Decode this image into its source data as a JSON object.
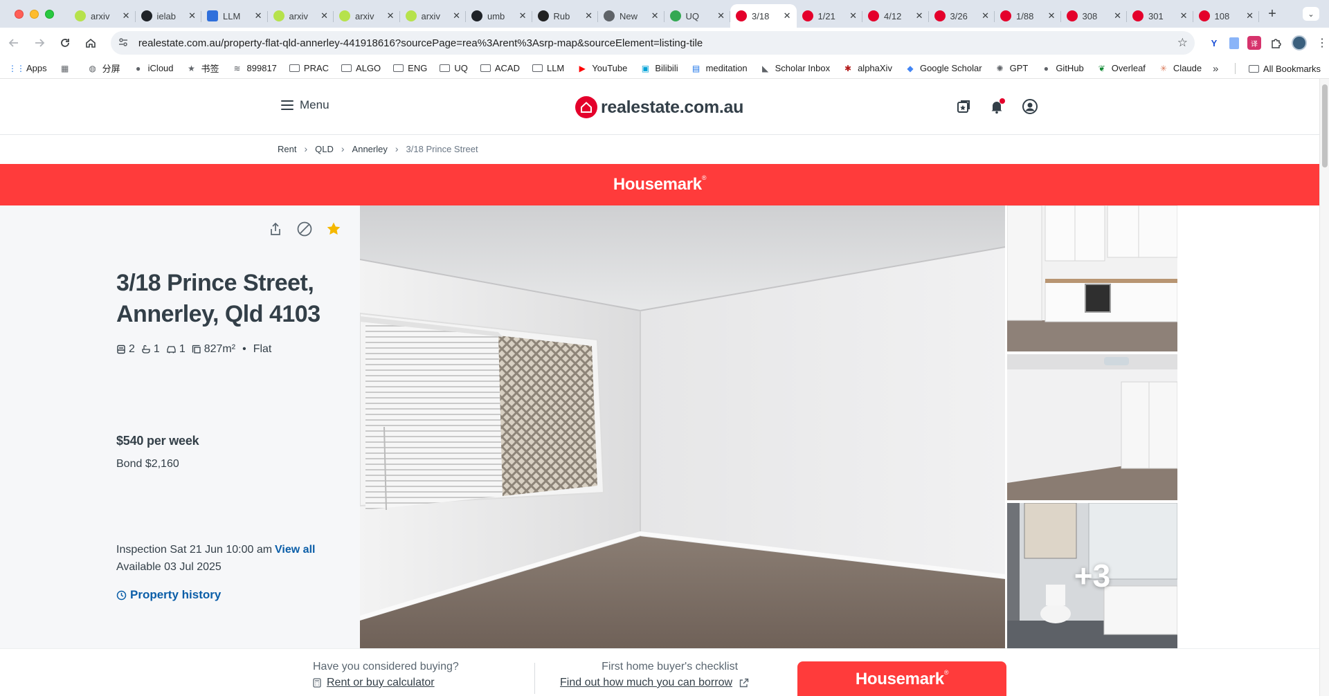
{
  "browser": {
    "tabs": [
      {
        "title": "arxiv",
        "icon": "arxiv-icon"
      },
      {
        "title": "ielab",
        "icon": "github-icon"
      },
      {
        "title": "LLM",
        "icon": "llm-icon"
      },
      {
        "title": "arxiv",
        "icon": "arxiv-icon"
      },
      {
        "title": "arxiv",
        "icon": "arxiv-icon"
      },
      {
        "title": "arxiv",
        "icon": "arxiv-icon"
      },
      {
        "title": "umb",
        "icon": "github-icon"
      },
      {
        "title": "Rub",
        "icon": "rub-icon"
      },
      {
        "title": "New",
        "icon": "globe-icon"
      },
      {
        "title": "UQ",
        "icon": "maps-icon"
      },
      {
        "title": "3/18",
        "icon": "realestate-icon",
        "active": true
      },
      {
        "title": "1/21",
        "icon": "realestate-icon"
      },
      {
        "title": "4/12",
        "icon": "realestate-icon"
      },
      {
        "title": "3/26",
        "icon": "realestate-icon"
      },
      {
        "title": "1/88",
        "icon": "realestate-icon"
      },
      {
        "title": "308",
        "icon": "realestate-icon"
      },
      {
        "title": "301",
        "icon": "realestate-icon"
      },
      {
        "title": "108",
        "icon": "realestate-icon"
      }
    ],
    "url": "realestate.com.au/property-flat-qld-annerley-441918616?sourcePage=rea%3Arent%3Asrp-map&sourceElement=listing-tile",
    "bookmarks": [
      {
        "label": "Apps",
        "icon": "apps-grid-icon"
      },
      {
        "label": "",
        "icon": "tab-groups-icon"
      },
      {
        "label": "分屏",
        "icon": "globe-icon"
      },
      {
        "label": "iCloud",
        "icon": "apple-icon"
      },
      {
        "label": "书签",
        "icon": "star-icon"
      },
      {
        "label": "899817",
        "icon": "wifi-icon"
      },
      {
        "label": "PRAC",
        "icon": "folder-icon"
      },
      {
        "label": "ALGO",
        "icon": "folder-icon"
      },
      {
        "label": "ENG",
        "icon": "folder-icon"
      },
      {
        "label": "UQ",
        "icon": "folder-icon"
      },
      {
        "label": "ACAD",
        "icon": "folder-icon"
      },
      {
        "label": "LLM",
        "icon": "folder-icon"
      },
      {
        "label": "YouTube",
        "icon": "youtube-icon"
      },
      {
        "label": "Bilibili",
        "icon": "bilibili-icon"
      },
      {
        "label": "meditation",
        "icon": "calendar-icon"
      },
      {
        "label": "Scholar Inbox",
        "icon": "scholar-inbox-icon"
      },
      {
        "label": "alphaXiv",
        "icon": "alphaxiv-icon"
      },
      {
        "label": "Google Scholar",
        "icon": "google-scholar-icon"
      },
      {
        "label": "GPT",
        "icon": "openai-icon"
      },
      {
        "label": "GitHub",
        "icon": "github-icon"
      },
      {
        "label": "Overleaf",
        "icon": "overleaf-icon"
      },
      {
        "label": "Claude",
        "icon": "claude-icon"
      }
    ],
    "more_bookmarks": "»",
    "all_bookmarks": "All Bookmarks"
  },
  "site": {
    "menu_label": "Menu",
    "logo_text": "realestate.com.au",
    "header_icons": [
      "saved-searches-icon",
      "bell-icon",
      "account-icon"
    ]
  },
  "breadcrumb": [
    "Rent",
    "QLD",
    "Annerley",
    "3/18 Prince Street"
  ],
  "agency": {
    "brand": "Housemark",
    "registered": "®",
    "color": "#ff3b3b"
  },
  "listing": {
    "address_line1": "3/18 Prince Street,",
    "address_line2": "Annerley, Qld 4103",
    "bedrooms": "2",
    "bathrooms": "1",
    "car_spaces": "1",
    "land_size": "827m²",
    "property_type": "Flat",
    "price": "$540 per week",
    "bond": "Bond $2,160",
    "inspection": "Inspection Sat 21 Jun 10:00 am",
    "inspection_link": "View all",
    "available": "Available 03 Jul 2025",
    "history_link": "Property history",
    "more_photos": "+3"
  },
  "bottom": {
    "buying_label": "Have you considered buying?",
    "buying_link": "Rent or buy calculator",
    "checklist_label": "First home buyer's checklist",
    "checklist_link": "Find out how much you can borrow",
    "brand": "Housemark",
    "registered": "®"
  },
  "colors": {
    "brand_red": "#e4002b",
    "agency_red": "#ff3b3b",
    "link_blue": "#0b5ea8",
    "text_dark": "#333f48"
  }
}
